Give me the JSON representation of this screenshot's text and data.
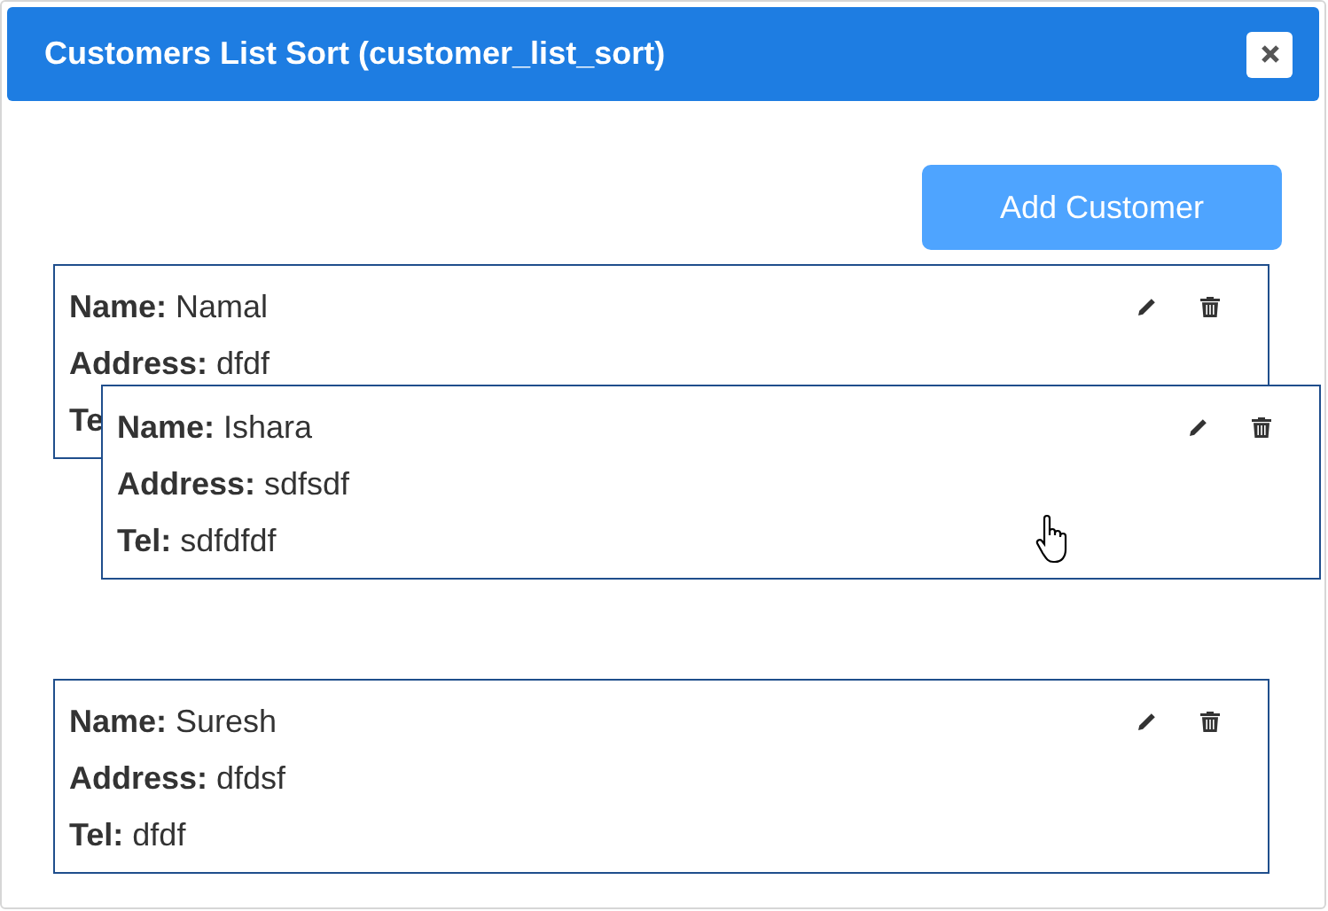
{
  "dialog": {
    "title": "Customers List Sort (customer_list_sort)"
  },
  "add_button": "Add Customer",
  "customers": [
    {
      "fields": [
        "**Name:** Namal",
        "**Address:** dfdf",
        "**Te**"
      ],
      "dragging": false
    },
    {
      "fields": [
        "**Name:** Ishara",
        "**Address:** sdfsdf",
        "**Tel:** sdfdfdf"
      ],
      "dragging": true
    },
    {
      "fields": [
        "**Name:** Suresh",
        "**Address:** dfdsf",
        "**Tel:** dfdf"
      ],
      "dragging": false
    }
  ]
}
